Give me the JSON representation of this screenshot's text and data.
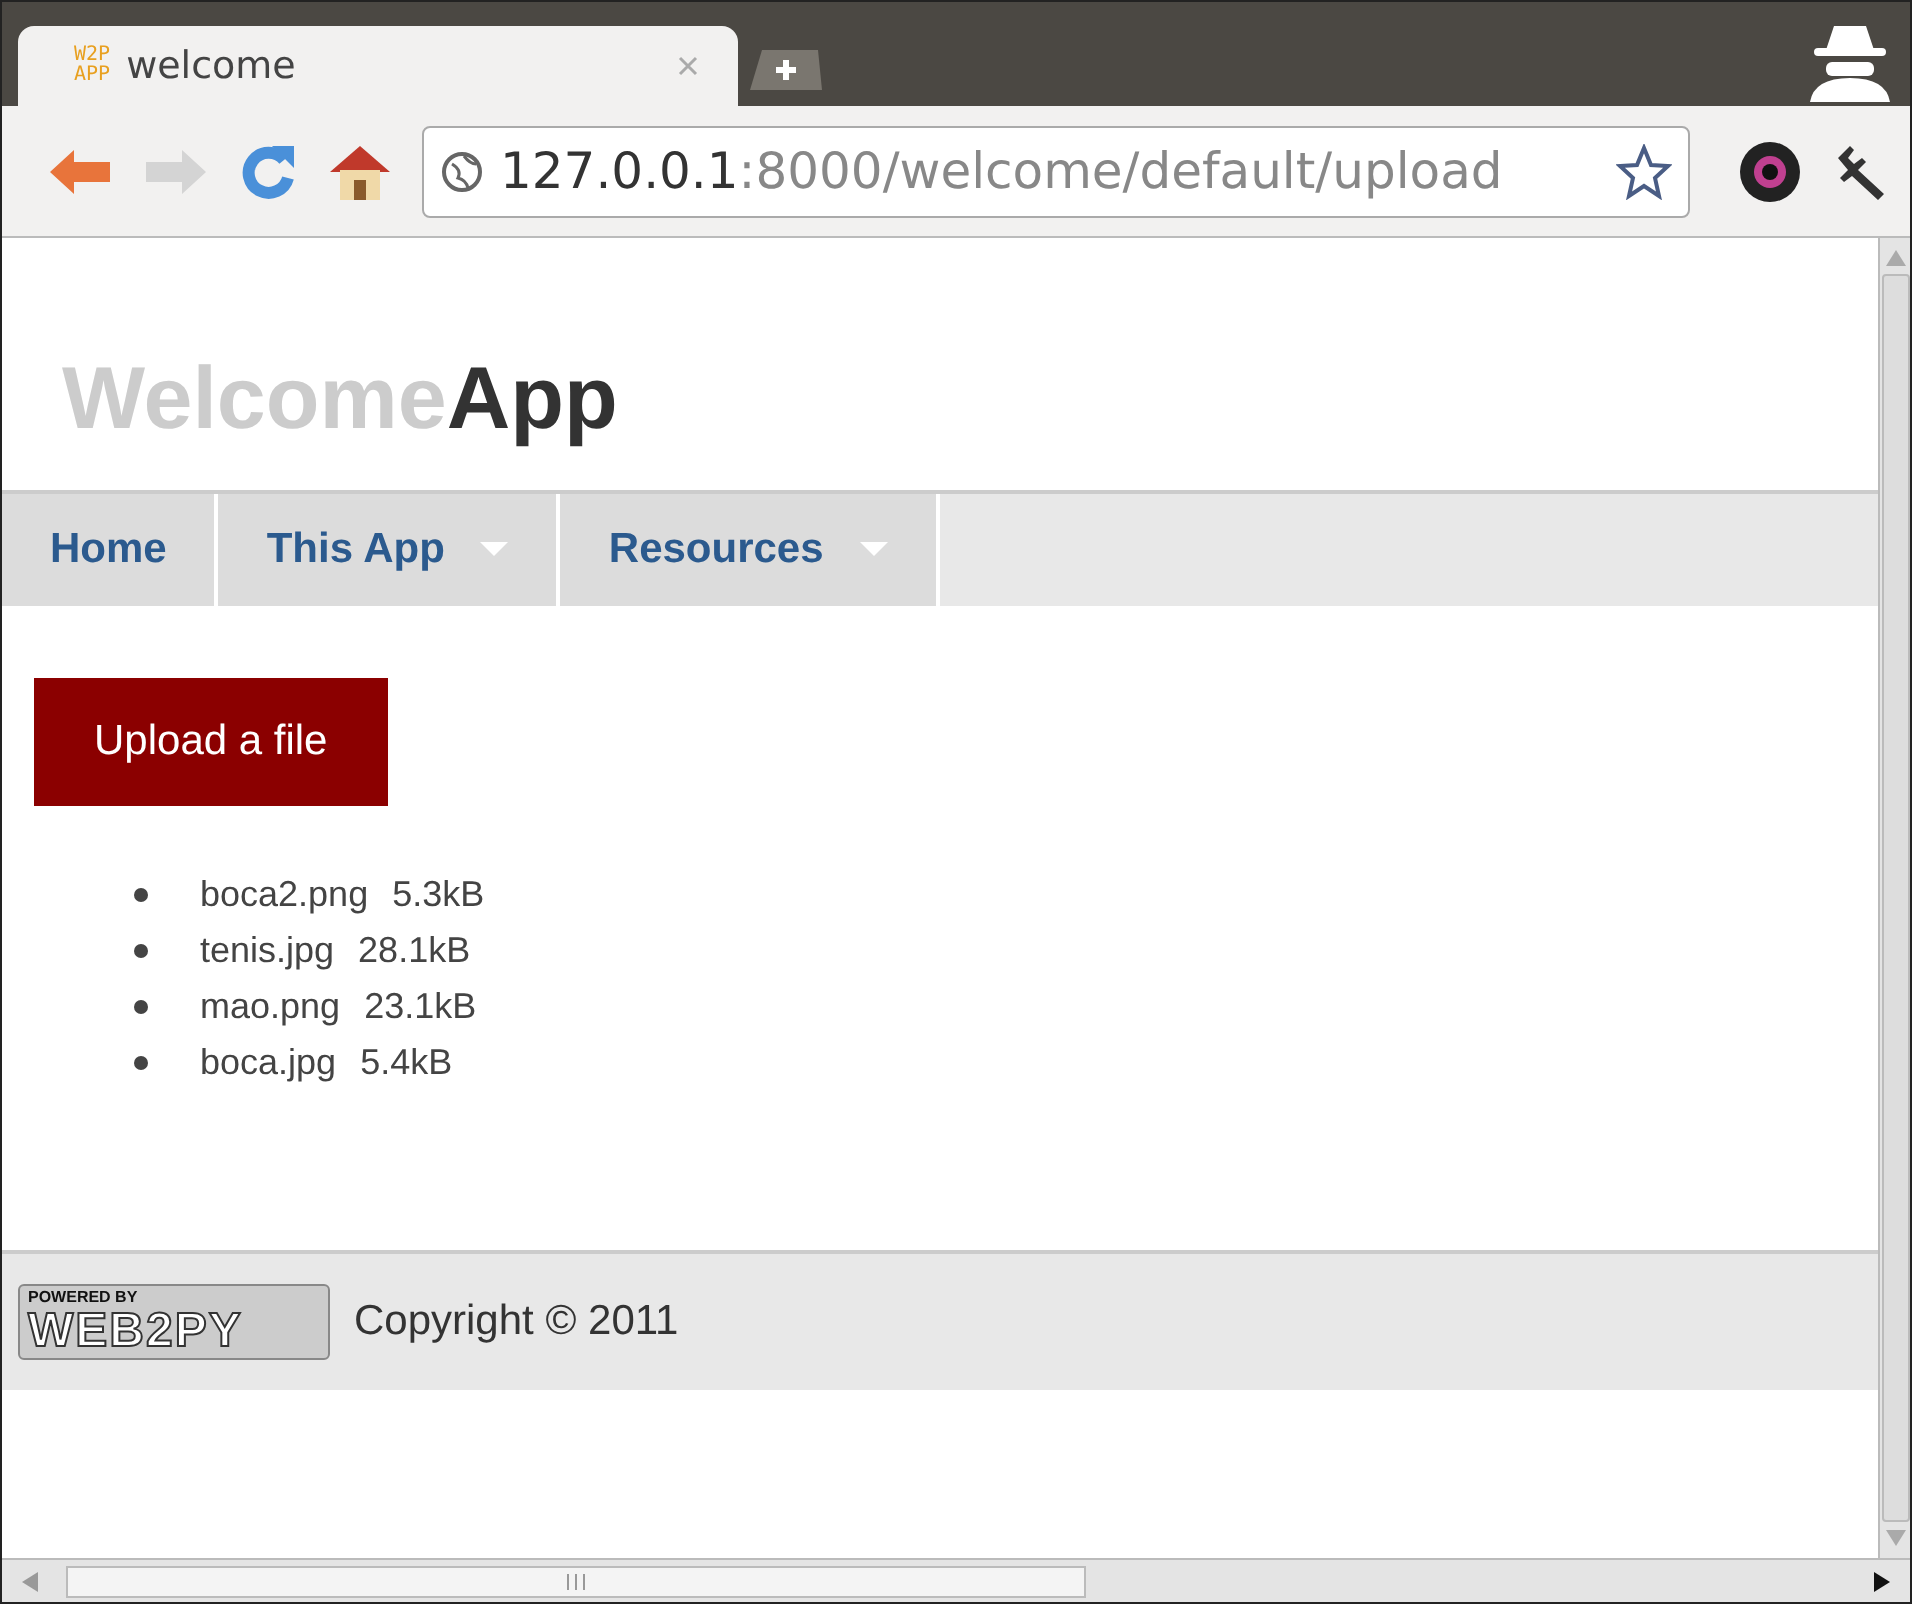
{
  "browser": {
    "tabs": [
      {
        "title": "welcome",
        "favicon": [
          "W2P",
          "APP"
        ],
        "selected": true
      }
    ],
    "url": {
      "host": "127.0.0.1",
      "path": ":8000/welcome/default/upload"
    }
  },
  "page": {
    "brand": {
      "light": "Welcome",
      "dark": "App"
    },
    "nav": [
      {
        "label": "Home",
        "has_menu": false
      },
      {
        "label": "This App",
        "has_menu": true
      },
      {
        "label": "Resources",
        "has_menu": true
      }
    ],
    "upload_button": "Upload a file",
    "files": [
      {
        "name": "boca2.png",
        "size": "5.3kB"
      },
      {
        "name": "tenis.jpg",
        "size": "28.1kB"
      },
      {
        "name": "mao.png",
        "size": "23.1kB"
      },
      {
        "name": "boca.jpg",
        "size": "5.4kB"
      }
    ],
    "footer": {
      "badge": {
        "top": "POWERED BY",
        "main": "WEB2PY"
      },
      "copyright": "Copyright © 2011"
    }
  }
}
